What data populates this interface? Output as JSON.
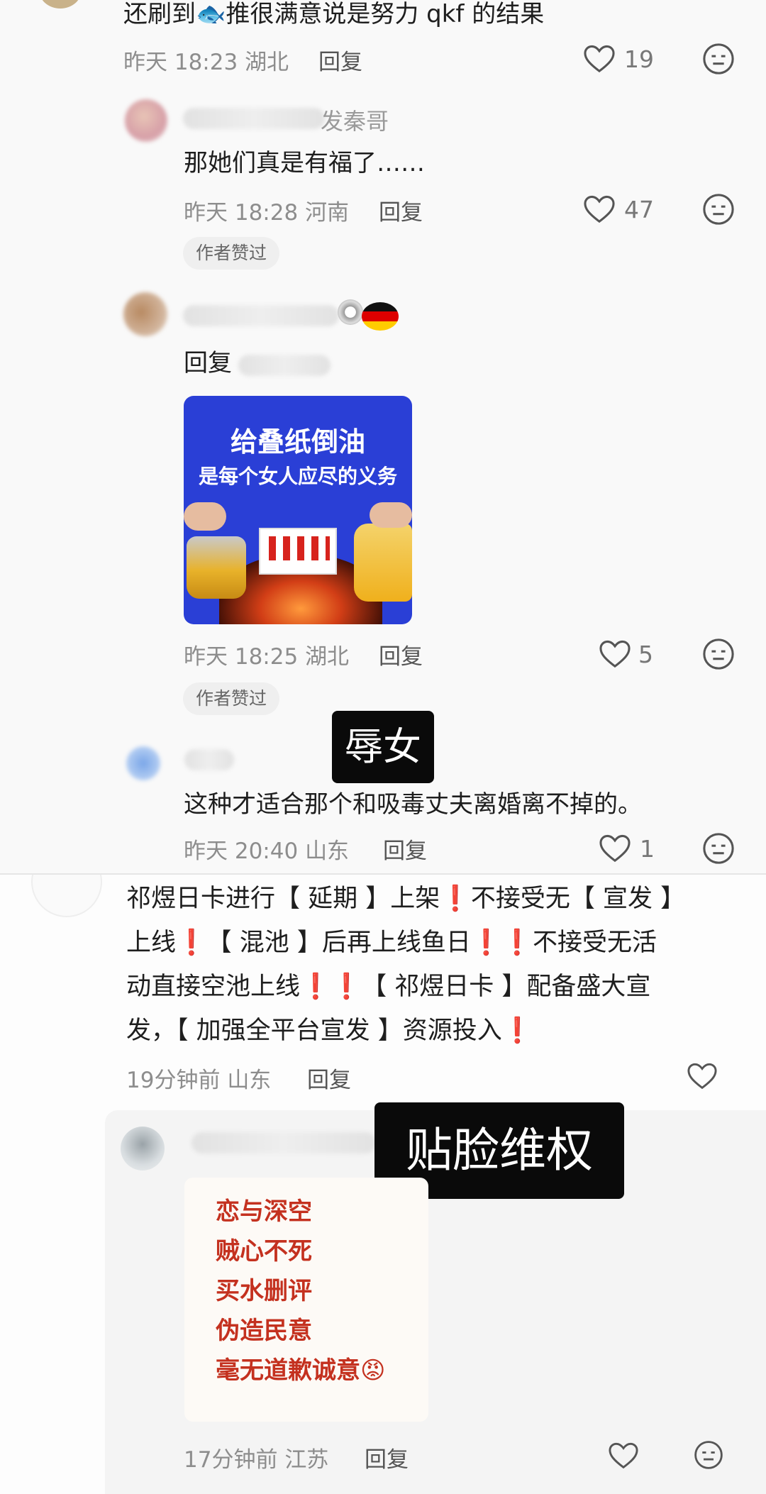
{
  "comment1": {
    "text": "还刷到🐟推很满意说是努力 qkf 的结果",
    "time": "昨天 18:23",
    "location": "湖北",
    "reply_label": "回复",
    "likes": "19"
  },
  "comment2": {
    "name_suffix": "发秦哥",
    "text": "那她们真是有福了……",
    "time": "昨天 18:28",
    "location": "河南",
    "reply_label": "回复",
    "likes": "47",
    "badge": "作者赞过"
  },
  "comment3": {
    "flag_icon": "soccer-germany-flag",
    "text_prefix": "回复",
    "image_title": "给叠纸倒油",
    "image_subtitle": "是每个女人应尽的义务",
    "time": "昨天 18:25",
    "location": "湖北",
    "reply_label": "回复",
    "likes": "5",
    "badge": "作者赞过"
  },
  "caption1": "辱女",
  "comment4": {
    "text": "这种才适合那个和吸毒丈夫离婚离不掉的。",
    "time": "昨天 20:40",
    "location": "山东",
    "reply_label": "回复",
    "likes": "1"
  },
  "comment5": {
    "lines": [
      "祁煜日卡进行【 延期 】上架❗️不接受无【 宣发 】",
      "上线❗️【 混池 】后再上线鱼日❗️❗️不接受无活",
      "动直接空池上线❗️❗️【 祁煜日卡 】配备盛大宣",
      "发，【 加强全平台宣发 】资源投入❗️"
    ],
    "time": "19分钟前",
    "location": "山东",
    "reply_label": "回复"
  },
  "caption2": "贴脸维权",
  "comment6": {
    "image_lines": [
      "恋与深空",
      "贼心不死",
      "买水删评",
      "伪造民意",
      "毫无道歉诚意😡"
    ],
    "time": "17分钟前",
    "location": "江苏",
    "reply_label": "回复"
  },
  "colors": {
    "meta_gray": "#8d8d8d",
    "caption_bg": "#0a0a0a",
    "image_blue": "#2a3fd6",
    "image_red_text": "#c4311f"
  }
}
